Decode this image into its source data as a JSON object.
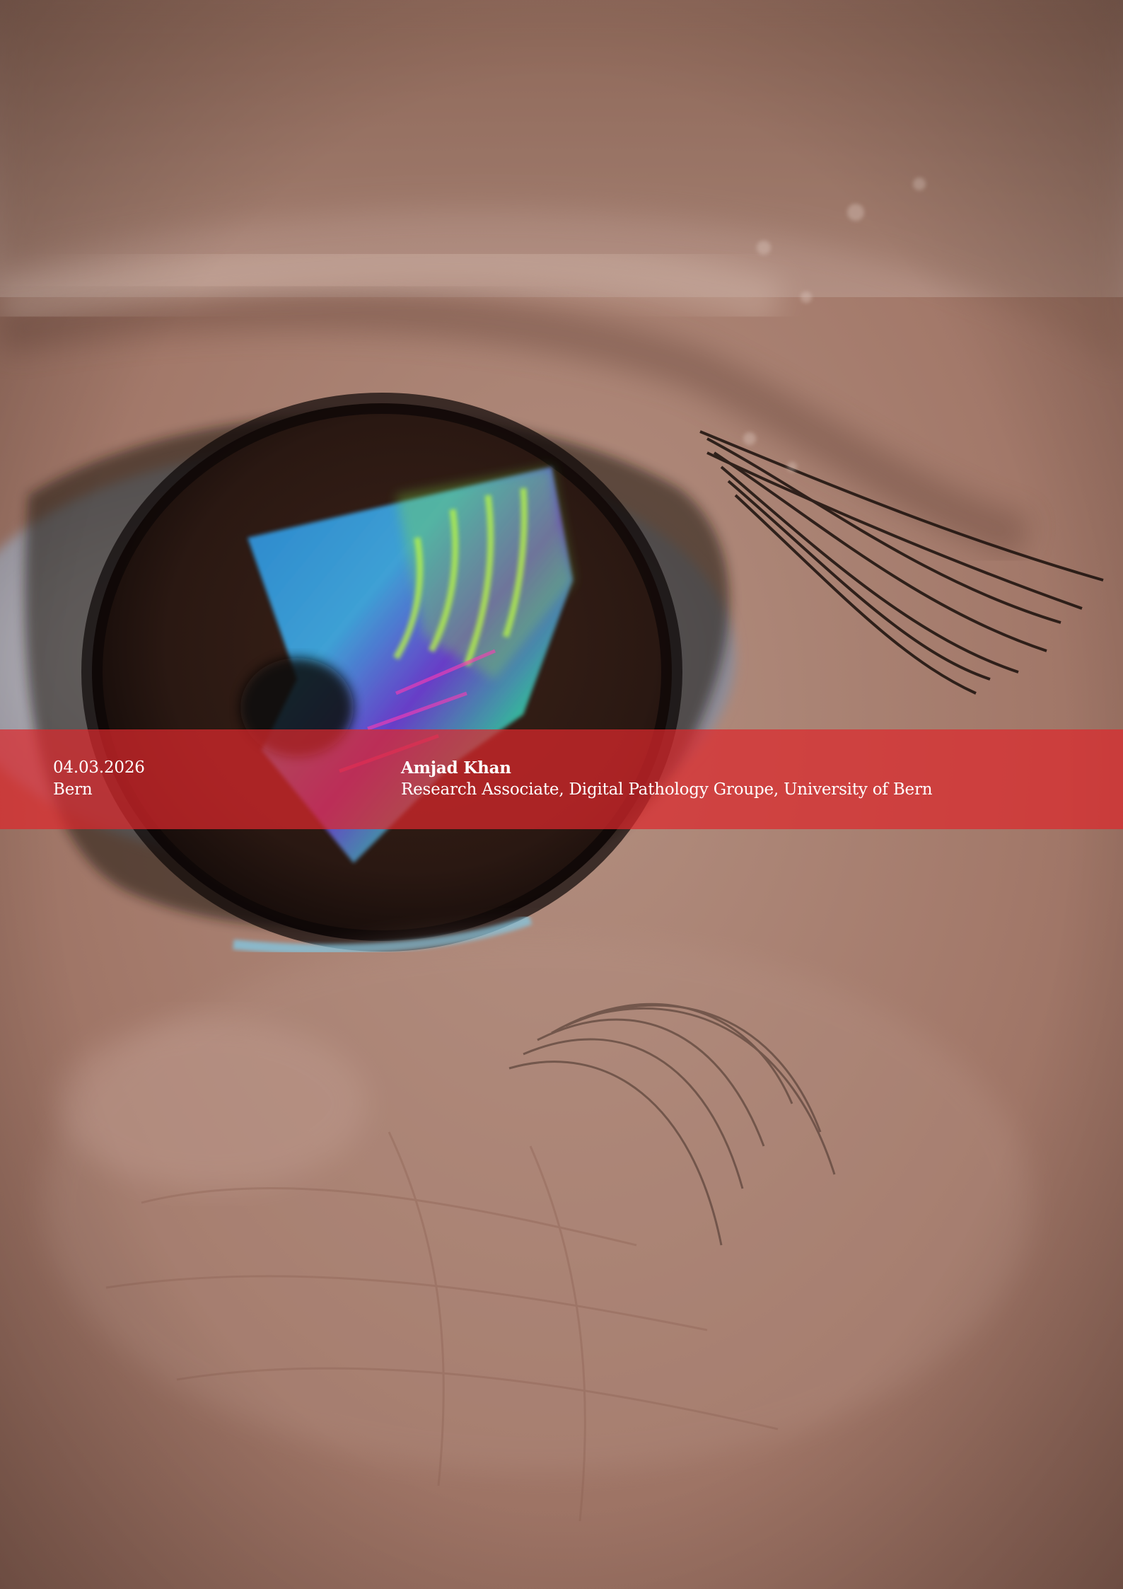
{
  "event": {
    "date": "04.03.2026",
    "location": "Bern"
  },
  "speaker": {
    "name": "Amjad Khan",
    "affiliation": "Research Associate, Digital Pathology Groupe, University of Bern"
  },
  "colors": {
    "band": "#dc282c",
    "text": "#ffffff"
  }
}
